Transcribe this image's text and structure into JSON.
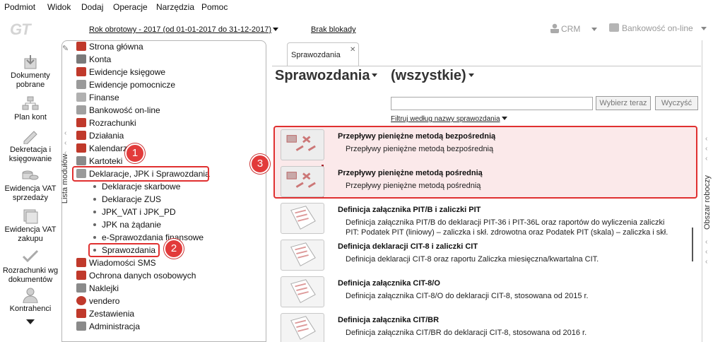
{
  "menu": [
    "Podmiot",
    "Widok",
    "Dodaj",
    "Operacje",
    "Narzędzia",
    "Pomoc"
  ],
  "topbar": {
    "logo_text": "GT",
    "year": "Rok obrotowy - 2017  (od 01-01-2017 do 31-12-2017)",
    "lock": "Brak blokady",
    "crm": "CRM",
    "bank": "Bankowość on-line"
  },
  "sidebar": [
    {
      "label": "Dokumenty pobrane",
      "icon": "download-docs-icon"
    },
    {
      "label": "Plan kont",
      "icon": "chart-of-accounts-icon"
    },
    {
      "label": "Dekretacja i księgowanie",
      "icon": "posting-icon"
    },
    {
      "label": "Ewidencja VAT sprzedaży",
      "icon": "vat-sales-icon"
    },
    {
      "label": "Ewidencja VAT zakupu",
      "icon": "vat-purchase-icon"
    },
    {
      "label": "Rozrachunki wg dokumentów",
      "icon": "settlements-icon"
    },
    {
      "label": "Kontrahenci",
      "icon": "contractors-icon"
    }
  ],
  "modules": {
    "strip_label": "Lista modułów",
    "items": [
      {
        "label": "Strona główna",
        "color": "#c0392b"
      },
      {
        "label": "Konta",
        "color": "#7a7a7a"
      },
      {
        "label": "Ewidencje księgowe",
        "color": "#c0392b"
      },
      {
        "label": "Ewidencje pomocnicze",
        "color": "#9a9a9a"
      },
      {
        "label": "Finanse",
        "color": "#b0b0b0"
      },
      {
        "label": "Bankowość on-line",
        "color": "#a0a0a0"
      },
      {
        "label": "Rozrachunki",
        "color": "#c0392b"
      },
      {
        "label": "Działania",
        "color": "#c0392b"
      },
      {
        "label": "Kalendarz",
        "color": "#c0392b"
      },
      {
        "label": "Kartoteki",
        "color": "#8a8a8a"
      },
      {
        "label": "Deklaracje, JPK i Sprawozdania",
        "color": "#9a9a9a"
      }
    ],
    "sub": [
      "Deklaracje skarbowe",
      "Deklaracje ZUS",
      "JPK_VAT i JPK_PD",
      "JPK na żądanie",
      "e-Sprawozdania finansowe",
      "Sprawozdania"
    ],
    "items2": [
      {
        "label": "Wiadomości SMS",
        "color": "#c0392b"
      },
      {
        "label": "Ochrona danych osobowych",
        "color": "#c0392b"
      },
      {
        "label": "Naklejki",
        "color": "#8a8a8a"
      },
      {
        "label": "vendero",
        "color": "#c0392b"
      },
      {
        "label": "Zestawienia",
        "color": "#c0392b"
      },
      {
        "label": "Administracja",
        "color": "#8a8a8a"
      }
    ]
  },
  "badges": [
    "1",
    "2",
    "3"
  ],
  "tab": {
    "label": "Sprawozdania",
    "close": "✕"
  },
  "main": {
    "title": "Sprawozdania",
    "filter_all": "(wszystkie)",
    "search_value": "",
    "select_btn": "Wybierz teraz",
    "clear_btn": "Wyczyść",
    "filter_label": "Filtruj według nazwy sprawozdania",
    "reports": [
      {
        "title": "Przepływy pieniężne metodą bezpośrednią",
        "desc": "Przepływy pieniężne metodą bezpośrednią"
      },
      {
        "title": "Przepływy pieniężne metodą pośrednią",
        "desc": "Przepływy pieniężne metodą pośrednią"
      },
      {
        "title": "Definicja załącznika PIT/B i zaliczki PIT",
        "desc": "Definicja załącznika PIT/B do deklaracji PIT-36 i PIT-36L oraz raportów do wyliczenia zaliczki\nPIT: Podatek PIT (liniowy) – zaliczka i skł. zdrowotna oraz Podatek PIT (skala) – zaliczka i skł."
      },
      {
        "title": "Definicja deklaracji CIT-8 i zaliczki CIT",
        "desc": "Definicja deklaracji CIT-8 oraz raportu Zaliczka miesięczna/kwartalna CIT."
      },
      {
        "title": "Definicja załącznika CIT-8/O",
        "desc": "Definicja załącznika CIT-8/O do deklaracji CIT-8, stosowana od 2015 r."
      },
      {
        "title": "Definicja załącznika CIT/BR",
        "desc": "Definicja załącznika CIT/BR do deklaracji CIT-8, stosowana od 2016 r."
      }
    ]
  },
  "right_strip": "Obszar roboczy"
}
